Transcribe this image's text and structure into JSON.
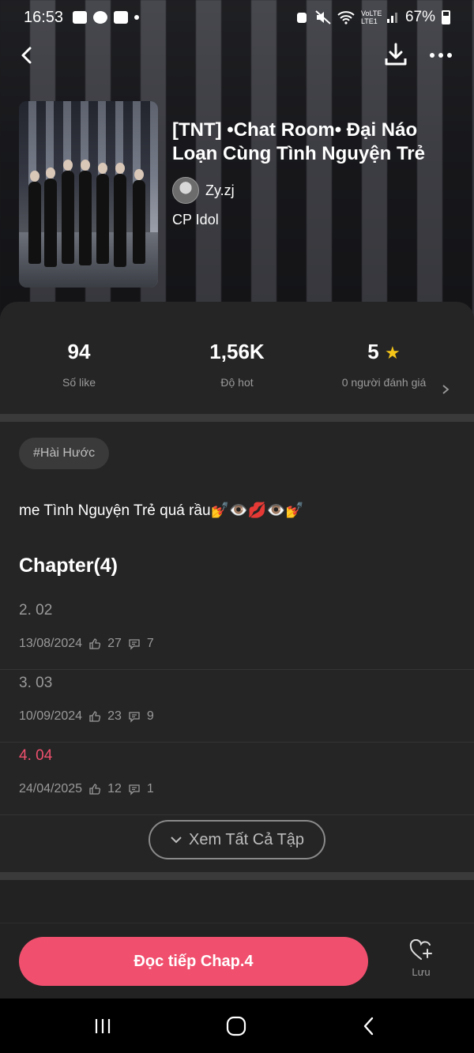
{
  "status_bar": {
    "time": "16:53",
    "network": "VoLTE LTE1",
    "battery": "67%"
  },
  "top_bar": {
    "back_icon": "back-arrow-icon",
    "download_icon": "download-icon",
    "more_icon": "more-dots-icon"
  },
  "book": {
    "title": "[TNT] •Chat Room• Đại Náo Loạn Cùng Tình Nguyện Trẻ",
    "author": "Zy.zj",
    "category": "CP Idol"
  },
  "stats": {
    "likes_value": "94",
    "likes_label": "Số like",
    "hot_value": "1,56K",
    "hot_label": "Độ hot",
    "rating_value": "5",
    "rating_label": "0 người đánh giá"
  },
  "tag": "#Hài Hước",
  "description": "me Tình Nguyện Trẻ quá rầu💅👁️💋👁️💅",
  "chapters": {
    "heading": "Chapter(4)",
    "items": [
      {
        "title": "2. 02",
        "date": "13/08/2024",
        "likes": "27",
        "comments": "7",
        "current": false
      },
      {
        "title": "3. 03",
        "date": "10/09/2024",
        "likes": "23",
        "comments": "9",
        "current": false
      },
      {
        "title": "4. 04",
        "date": "24/04/2025",
        "likes": "12",
        "comments": "1",
        "current": true
      }
    ],
    "view_all": "Xem Tất Cả Tập"
  },
  "actions": {
    "read_button": "Đọc tiếp Chap.4",
    "save_label": "Lưu"
  },
  "colors": {
    "accent": "#f0506e",
    "background": "#222222",
    "panel": "#252525",
    "muted_text": "#9a9a9a",
    "star": "#f5c518"
  }
}
